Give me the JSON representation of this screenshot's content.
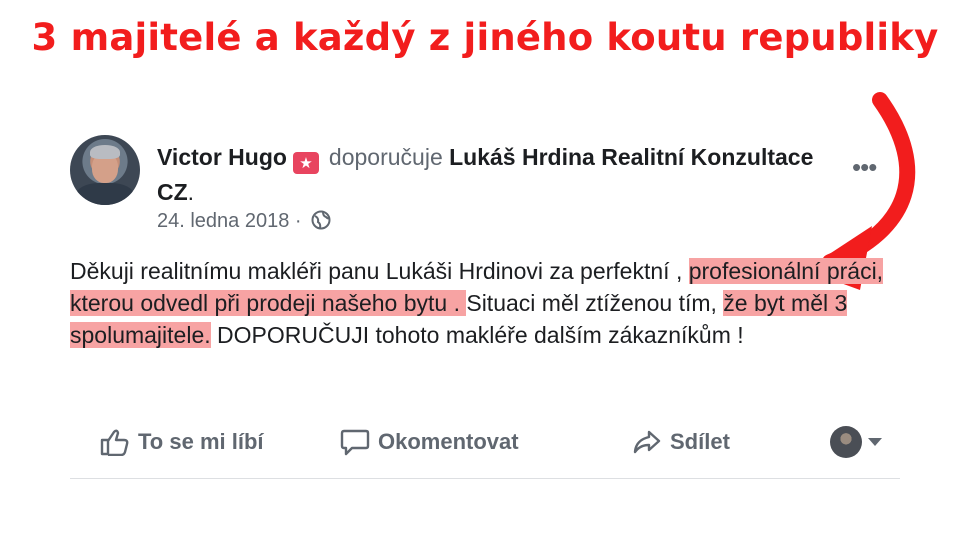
{
  "headline": "3 majitelé a každý z jiného koutu republiky",
  "post": {
    "author": "Victor Hugo",
    "verb": "doporučuje",
    "page_name": "Lukáš Hrdina Realitní Konzultace CZ",
    "page_suffix": ".",
    "date": "24. ledna 2018",
    "date_separator": "·",
    "body_part1": "Děkuji realitnímu makléři panu Lukáši Hrdinovi za perfektní , ",
    "body_highlight1": "profesionální práci, kterou odvedl při prodeji našeho bytu . ",
    "body_part2": "Situaci měl ztíženou tím, ",
    "body_highlight2": "že byt měl 3 spolumajitele.",
    "body_part3": " DOPORUČUJI tohoto makléře dalším zákazníkům !"
  },
  "actions": {
    "like": "To se mi líbí",
    "comment": "Okomentovat",
    "share": "Sdílet"
  },
  "colors": {
    "headline": "#f21d1d",
    "arrow": "#f21d1d",
    "highlight": "#f7a3a3",
    "badge": "#e8445f",
    "muted": "#606770"
  },
  "icons": [
    "recommend-badge-icon",
    "globe-icon",
    "more-options-icon",
    "like-thumb-icon",
    "comment-bubble-icon",
    "share-arrow-icon",
    "caret-down-icon",
    "curved-arrow-icon"
  ]
}
